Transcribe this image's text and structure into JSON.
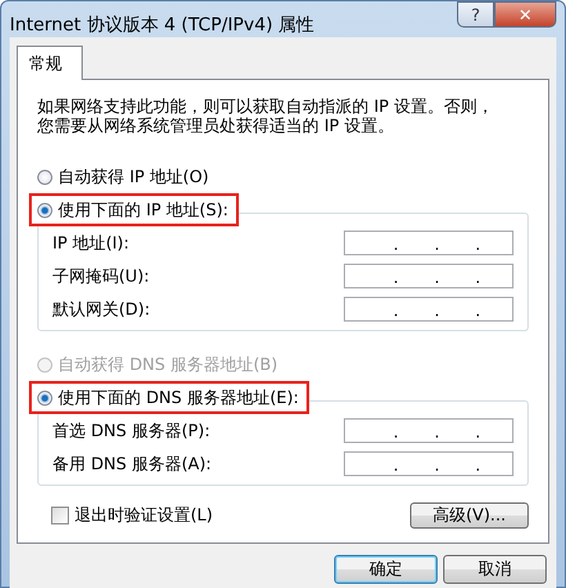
{
  "window": {
    "title": "Internet 协议版本 4 (TCP/IPv4) 属性",
    "help": "?",
    "close": "✕"
  },
  "tabs": [
    {
      "label": "常规",
      "selected": true
    }
  ],
  "description": "如果网络支持此功能，则可以获取自动指派的 IP 设置。否则，您需要从网络系统管理员处获得适当的 IP 设置。",
  "ip_mode": [
    {
      "label": "自动获得 IP 地址(O)",
      "selected": false,
      "disabled": false,
      "highlighted": false
    },
    {
      "label": "使用下面的 IP 地址(S):",
      "selected": true,
      "disabled": false,
      "highlighted": true
    }
  ],
  "ip_fields": [
    {
      "label": "IP 地址(I):",
      "dots": [
        ".",
        ".",
        "."
      ]
    },
    {
      "label": "子网掩码(U):",
      "dots": [
        ".",
        ".",
        "."
      ]
    },
    {
      "label": "默认网关(D):",
      "dots": [
        ".",
        ".",
        "."
      ]
    }
  ],
  "dns_mode": [
    {
      "label": "自动获得 DNS 服务器地址(B)",
      "selected": false,
      "disabled": true,
      "highlighted": false
    },
    {
      "label": "使用下面的 DNS 服务器地址(E):",
      "selected": true,
      "disabled": false,
      "highlighted": true
    }
  ],
  "dns_fields": [
    {
      "label": "首选 DNS 服务器(P):",
      "dots": [
        ".",
        ".",
        "."
      ]
    },
    {
      "label": "备用 DNS 服务器(A):",
      "dots": [
        ".",
        ".",
        "."
      ]
    }
  ],
  "validate_on_exit": {
    "label": "退出时验证设置(L)",
    "checked": false
  },
  "advanced_button": "高级(V)...",
  "buttons": [
    {
      "label": "确定",
      "kind": "default"
    },
    {
      "label": "取消",
      "kind": "normal"
    }
  ]
}
